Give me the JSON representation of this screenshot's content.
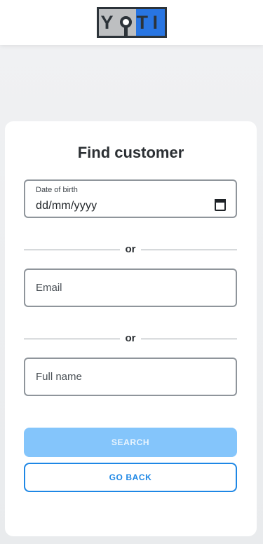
{
  "header": {
    "logo_text_left": "YO",
    "logo_text_right": "TI"
  },
  "form": {
    "title": "Find customer",
    "date_of_birth": {
      "label": "Date of birth",
      "value": "dd/mm/yyyy"
    },
    "separator_1": "or",
    "email": {
      "placeholder": "Email"
    },
    "separator_2": "or",
    "full_name": {
      "placeholder": "Full name"
    },
    "search_label": "SEARCH",
    "back_label": "GO BACK"
  },
  "colors": {
    "logo_blue": "#2875e2",
    "primary_disabled": "#84c5fb",
    "primary": "#1e87e5"
  },
  "icons": {
    "calendar": "calendar-icon"
  }
}
